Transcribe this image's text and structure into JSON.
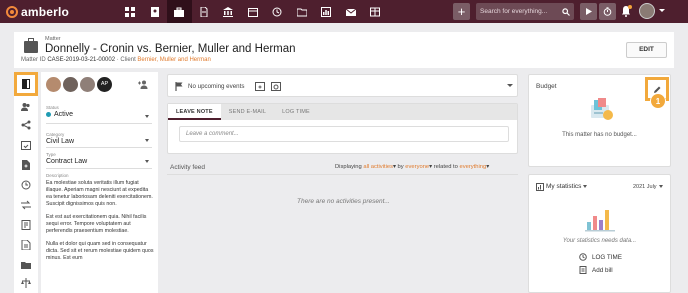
{
  "app": {
    "brand": "amberlo",
    "search_placeholder": "Search for everything...",
    "plus_label": "+"
  },
  "header": {
    "tag": "Matter",
    "title": "Donnelly - Cronin vs. Bernier, Muller and Herman",
    "id_label": "Matter ID",
    "id_value": "CASE-2019-03-21-00002",
    "separator": "·",
    "client_label": "Client",
    "client_value": "Bernier, Muller and Herman",
    "edit_label": "EDIT"
  },
  "participants": {
    "initials": "AP"
  },
  "fields": {
    "status": {
      "label": "Status",
      "value": "Active"
    },
    "category": {
      "label": "Category",
      "value": "Civil Law"
    },
    "type": {
      "label": "Type",
      "value": "Contract Law"
    },
    "description_label": "Description",
    "description": [
      "Ea molestiae soluta veritatis illum fugiat illaque. Aperiam magni nesciunt at expedita ea tenetur laboriosam deleniti exercitationem. Suscipit dignissimos quis non.",
      "Est est aut exercitationem quia. Nihil facilis sequi error. Tempore voluptatem aut perferendis praesentium molestiae.",
      "Nulla et dolor qui quam sed in consequatur dicta. Sed sit et rerum molestiae quidem quos minus. Est eum"
    ]
  },
  "events": {
    "label": "No upcoming events"
  },
  "note": {
    "tabs": [
      "LEAVE NOTE",
      "SEND E-MAIL",
      "LOG TIME"
    ],
    "placeholder": "Leave a comment..."
  },
  "feed": {
    "title": "Activity feed",
    "filter_prefix": "Displaying",
    "filter_activities": "all activities",
    "filter_by": "by",
    "filter_person": "everyone",
    "filter_related": "related to",
    "filter_everything": "everything",
    "empty": "There are no activities present..."
  },
  "budget": {
    "title": "Budget",
    "empty": "This matter has no budget...",
    "step_badge": "1"
  },
  "stats": {
    "title": "My statistics",
    "month": "2021 July",
    "empty": "Your statistics needs data...",
    "log_time": "LOG TIME",
    "add_bill": "Add bill"
  },
  "colors": {
    "topbar": "#4e1f2e",
    "accent": "#e07a2c",
    "highlight": "#f2a93c",
    "status_active": "#1f9bb3"
  }
}
